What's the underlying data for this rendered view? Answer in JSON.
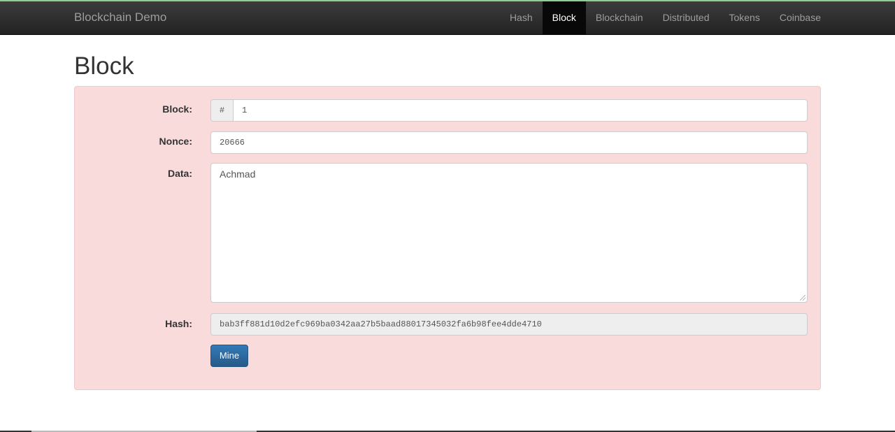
{
  "navbar": {
    "brand": "Blockchain Demo",
    "items": [
      {
        "label": "Hash",
        "active": false
      },
      {
        "label": "Block",
        "active": true
      },
      {
        "label": "Blockchain",
        "active": false
      },
      {
        "label": "Distributed",
        "active": false
      },
      {
        "label": "Tokens",
        "active": false
      },
      {
        "label": "Coinbase",
        "active": false
      }
    ]
  },
  "page": {
    "title": "Block"
  },
  "form": {
    "block_label": "Block:",
    "block_addon": "#",
    "block_value": "1",
    "nonce_label": "Nonce:",
    "nonce_value": "20666",
    "data_label": "Data:",
    "data_value": "Achmad",
    "hash_label": "Hash:",
    "hash_value": "bab3ff881d10d2efc969ba0342aa27b5baad88017345032fa6b98fee4dde4710",
    "mine_label": "Mine"
  },
  "colors": {
    "well_background": "#f9dbdc",
    "primary_button": "#337ab7"
  }
}
